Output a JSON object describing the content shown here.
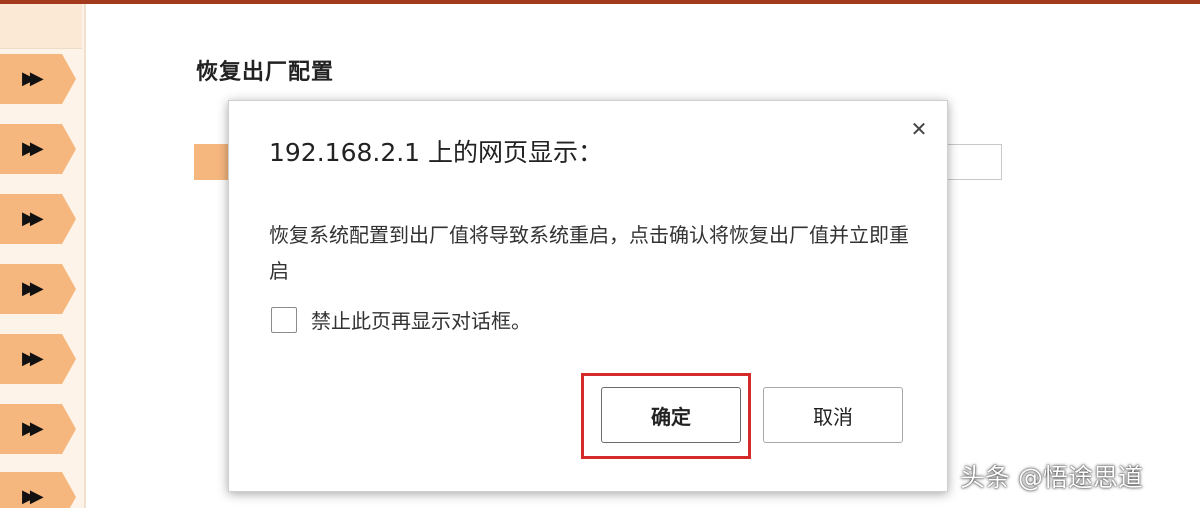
{
  "page": {
    "section_title": "恢复出厂配置"
  },
  "sidebar": {
    "items": [
      {
        "icon": "double-chevron-right-icon",
        "glyph": "▶▶"
      },
      {
        "icon": "double-chevron-right-icon",
        "glyph": "▶▶"
      },
      {
        "icon": "double-chevron-right-icon",
        "glyph": "▶▶"
      },
      {
        "icon": "double-chevron-right-icon",
        "glyph": "▶▶"
      },
      {
        "icon": "double-chevron-right-icon",
        "glyph": "▶▶"
      },
      {
        "icon": "double-chevron-right-icon",
        "glyph": "▶▶"
      },
      {
        "icon": "double-chevron-right-icon",
        "glyph": "▶▶"
      }
    ],
    "item_color": "#f6b77e"
  },
  "dialog": {
    "title": "192.168.2.1 上的网页显示：",
    "close_glyph": "✕",
    "message": "恢复系统配置到出厂值将导致系统重启，点击确认将恢复出厂值并立即重启",
    "checkbox_label": "禁止此页再显示对话框。",
    "ok_label": "确定",
    "cancel_label": "取消",
    "highlight_color": "#d42a2a"
  },
  "watermark": {
    "text": "头条 @悟途思道"
  },
  "colors": {
    "top_bar": "#a33a1e",
    "accent": "#f6b77e"
  }
}
